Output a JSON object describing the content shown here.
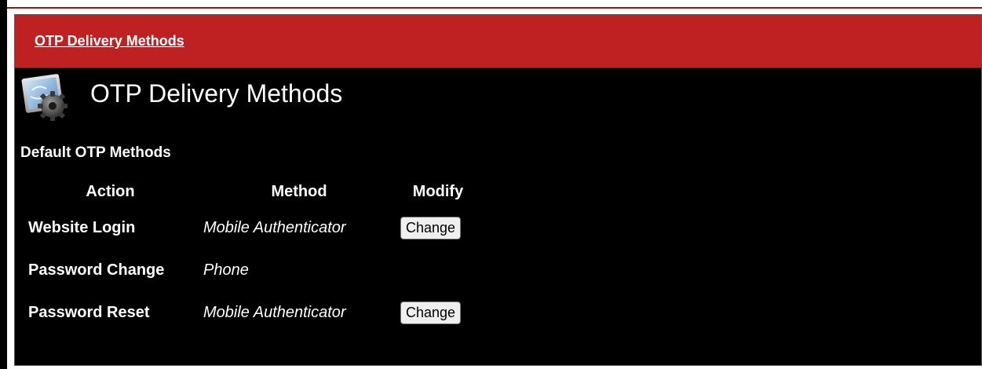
{
  "header": {
    "link_label": "OTP Delivery Methods"
  },
  "title": {
    "text": "OTP Delivery Methods",
    "icon": "system-preferences-gear-icon"
  },
  "section": {
    "heading": "Default OTP Methods"
  },
  "table": {
    "columns": [
      "Action",
      "Method",
      "Modify"
    ],
    "rows": [
      {
        "action": "Website Login",
        "method": "Mobile Authenticator",
        "modify_label": "Change"
      },
      {
        "action": "Password Change",
        "method": "Phone",
        "modify_label": ""
      },
      {
        "action": "Password Reset",
        "method": "Mobile Authenticator",
        "modify_label": "Change"
      }
    ]
  },
  "colors": {
    "header_red": "#bf2022",
    "panel_background": "#000000",
    "text": "#ffffff"
  }
}
